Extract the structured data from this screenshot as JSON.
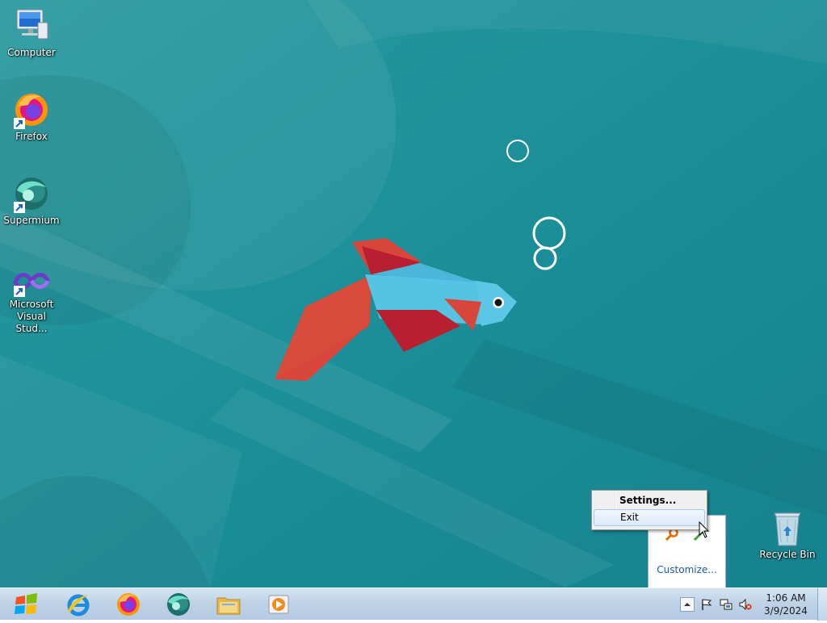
{
  "desktop": {
    "icons": [
      {
        "label": "Computer",
        "icon": "computer-icon"
      },
      {
        "label": "Firefox",
        "icon": "firefox-icon"
      },
      {
        "label": "Supermium",
        "icon": "supermium-icon"
      },
      {
        "label": "Microsoft Visual Stud...",
        "icon": "visual-studio-icon"
      },
      {
        "label": "Recycle Bin",
        "icon": "recycle-bin-icon"
      }
    ]
  },
  "context_menu": {
    "items": [
      {
        "label": "Settings...",
        "default": true
      },
      {
        "label": "Exit",
        "highlighted": true
      }
    ]
  },
  "tray_overflow": {
    "customize_label": "Customize...",
    "icons": [
      "tool-search-icon",
      "green-app-icon"
    ]
  },
  "taskbar": {
    "pinned": [
      {
        "name": "internet-explorer-icon"
      },
      {
        "name": "firefox-icon"
      },
      {
        "name": "supermium-icon"
      },
      {
        "name": "file-explorer-icon"
      },
      {
        "name": "media-player-icon"
      }
    ],
    "tray_icons": [
      "show-hidden-icons-arrow",
      "action-center-flag-icon",
      "network-icon",
      "volume-muted-icon"
    ],
    "clock": {
      "time": "1:06 AM",
      "date": "3/9/2024"
    }
  },
  "colors": {
    "wallpaper": "#1f8f98",
    "fish_body": "#56c3e3",
    "fish_fin_red": "#d8453a",
    "fish_fin_dark": "#b81f30"
  }
}
